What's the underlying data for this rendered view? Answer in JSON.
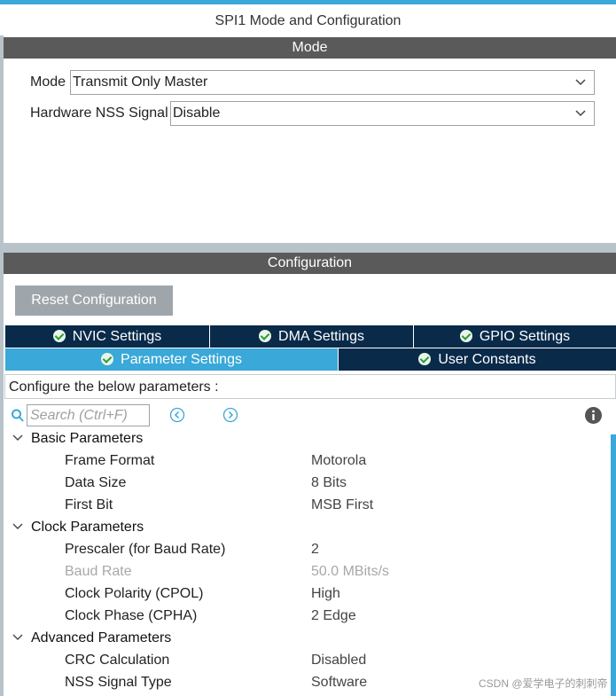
{
  "panel_title": "SPI1 Mode and Configuration",
  "mode_header": "Mode",
  "mode": {
    "mode_label": "Mode",
    "mode_value": "Transmit Only Master",
    "nss_label": "Hardware NSS Signal",
    "nss_value": "Disable"
  },
  "config_header": "Configuration",
  "reset_button": "Reset Configuration",
  "tabs": {
    "row1": [
      "NVIC Settings",
      "DMA Settings",
      "GPIO Settings"
    ],
    "row2": [
      "Parameter Settings",
      "User Constants"
    ],
    "active": "Parameter Settings"
  },
  "configure_label": "Configure the below parameters :",
  "search_placeholder": "Search (Ctrl+F)",
  "groups": [
    {
      "name": "Basic Parameters",
      "params": [
        {
          "name": "Frame Format",
          "value": "Motorola"
        },
        {
          "name": "Data Size",
          "value": "8 Bits"
        },
        {
          "name": "First Bit",
          "value": "MSB First"
        }
      ]
    },
    {
      "name": "Clock Parameters",
      "params": [
        {
          "name": "Prescaler (for Baud Rate)",
          "value": "2"
        },
        {
          "name": "Baud Rate",
          "value": "50.0 MBits/s",
          "disabled": true
        },
        {
          "name": "Clock Polarity (CPOL)",
          "value": "High"
        },
        {
          "name": "Clock Phase (CPHA)",
          "value": "2 Edge"
        }
      ]
    },
    {
      "name": "Advanced Parameters",
      "params": [
        {
          "name": "CRC Calculation",
          "value": "Disabled"
        },
        {
          "name": "NSS Signal Type",
          "value": "Software"
        }
      ]
    }
  ],
  "watermark": "CSDN @爱学电子的刺刺帝",
  "colors": {
    "accent": "#3aa8d8",
    "tab_dark": "#0a2a4a",
    "header_gray": "#5a5a5a",
    "button_gray": "#9fa6ab"
  },
  "icons": [
    "chevron-down-icon",
    "check-circle-icon",
    "search-icon",
    "expand-all-icon",
    "collapse-all-icon",
    "info-icon"
  ]
}
